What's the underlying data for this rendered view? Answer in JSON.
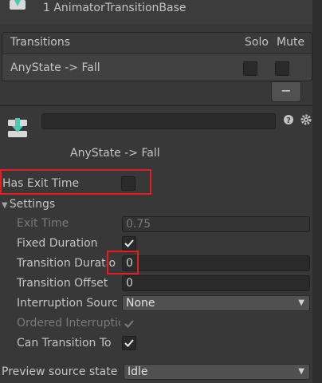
{
  "header": {
    "title": "1 AnimatorTransitionBase"
  },
  "transitions": {
    "header_title": "Transitions",
    "solo_label": "Solo",
    "mute_label": "Mute",
    "rows": [
      {
        "label": "AnyState -> Fall",
        "solo": false,
        "mute": false
      }
    ],
    "remove_label": "−"
  },
  "inspector": {
    "name_value": "",
    "subtitle": "AnyState -> Fall",
    "has_exit_time": {
      "label": "Has Exit Time",
      "checked": false
    },
    "settings": {
      "label": "Settings",
      "exit_time": {
        "label": "Exit Time",
        "value": "0.75"
      },
      "fixed_duration": {
        "label": "Fixed Duration",
        "checked": true
      },
      "transition_duration": {
        "label": "Transition Duratio",
        "value": "0"
      },
      "transition_offset": {
        "label": "Transition Offset",
        "value": "0"
      },
      "interruption_source": {
        "label": "Interruption Sourc",
        "value": "None"
      },
      "ordered_interruption": {
        "label": "Ordered Interruptic",
        "checked": true
      },
      "can_transition_to_self": {
        "label": "Can Transition To",
        "checked": true
      }
    },
    "preview_source_state": {
      "label": "Preview source state",
      "value": "Idle"
    }
  },
  "colors": {
    "highlight": "#e02020",
    "icon_accent": "#4ec9b0",
    "panel_bg": "#383838"
  }
}
